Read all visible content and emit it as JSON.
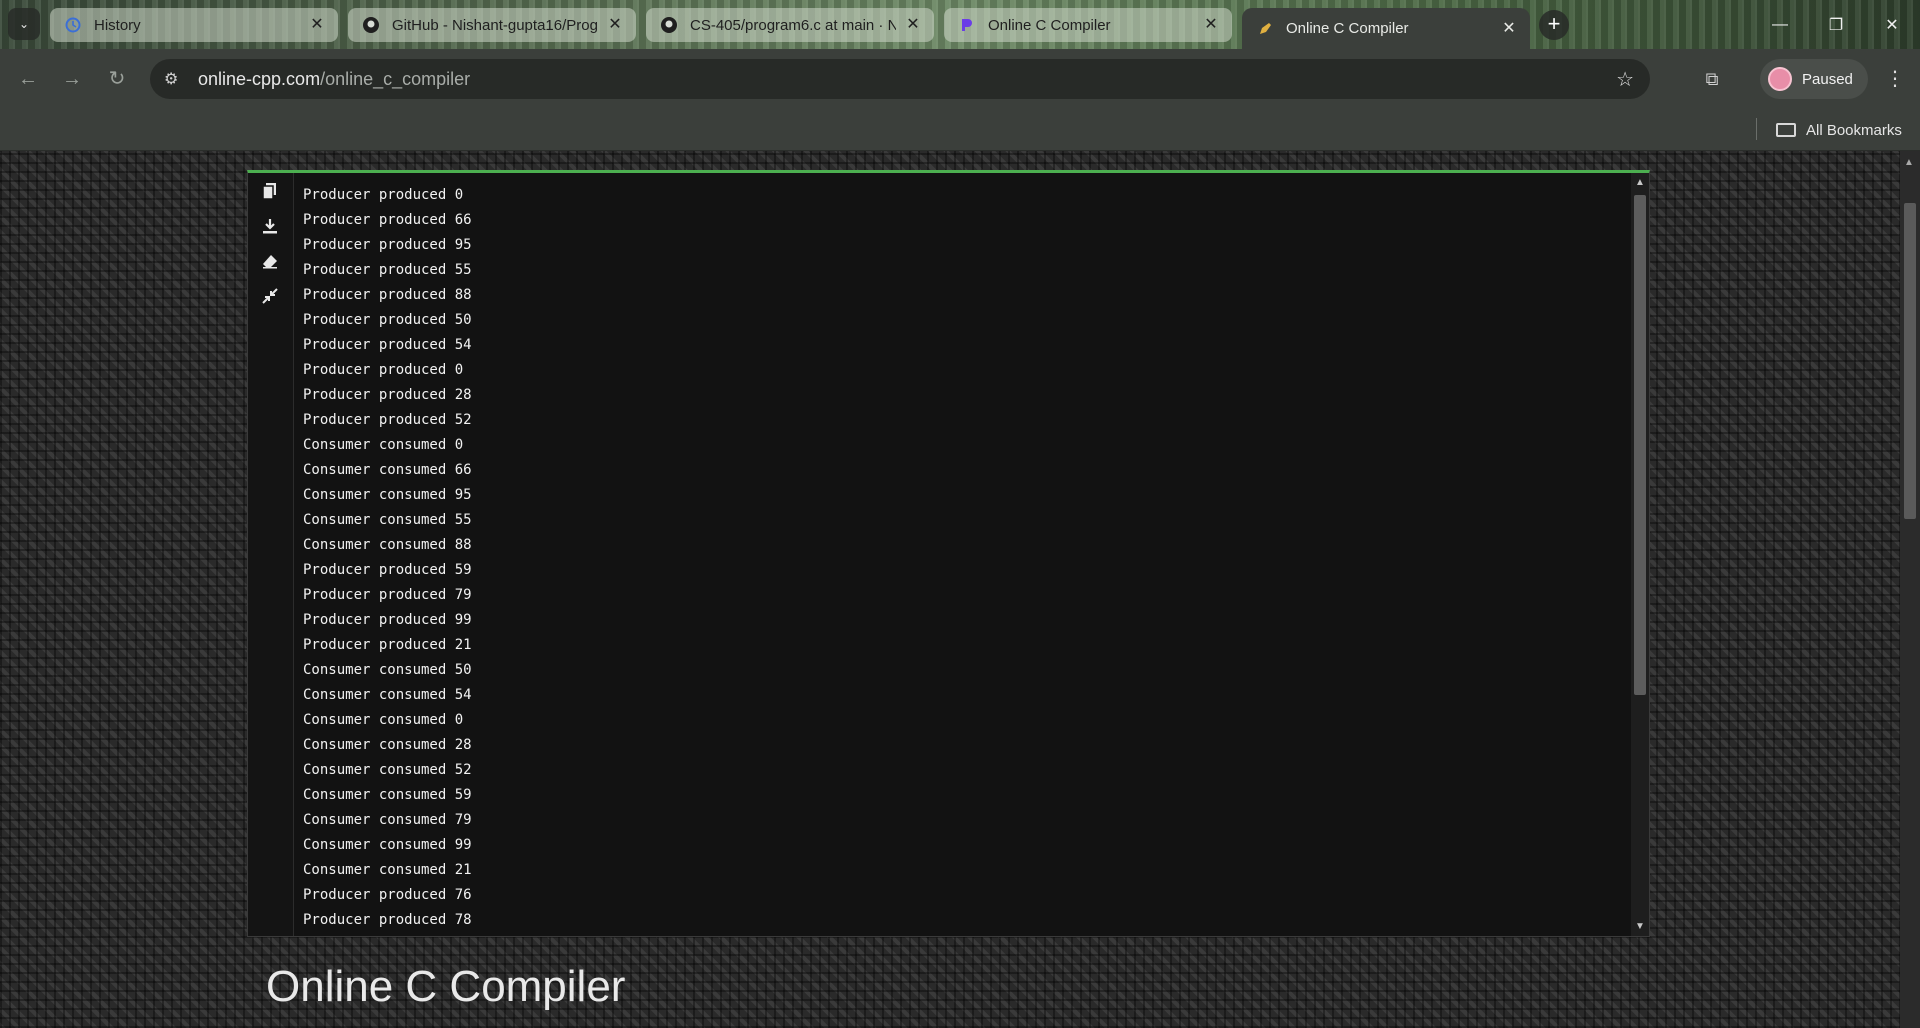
{
  "browser": {
    "tabs": [
      {
        "title": "History",
        "icon": "history-icon",
        "active": false
      },
      {
        "title": "GitHub - Nishant-gupta16/Prog",
        "icon": "github-icon",
        "active": false
      },
      {
        "title": "CS-405/program6.c at main · N",
        "icon": "github-icon",
        "active": false
      },
      {
        "title": "Online C Compiler",
        "icon": "compiler-p-icon",
        "active": false
      },
      {
        "title": "Online C Compiler",
        "icon": "compiler-pen-icon",
        "active": true
      }
    ],
    "url_host": "online-cpp.com",
    "url_path": "/online_c_compiler",
    "profile_label": "Paused",
    "bookmarks_label": "All Bookmarks"
  },
  "console": {
    "lines": [
      "Producer produced 0",
      "Producer produced 66",
      "Producer produced 95",
      "Producer produced 55",
      "Producer produced 88",
      "Producer produced 50",
      "Producer produced 54",
      "Producer produced 0",
      "Producer produced 28",
      "Producer produced 52",
      "Consumer consumed 0",
      "Consumer consumed 66",
      "Consumer consumed 95",
      "Consumer consumed 55",
      "Consumer consumed 88",
      "Producer produced 59",
      "Producer produced 79",
      "Producer produced 99",
      "Producer produced 21",
      "Consumer consumed 50",
      "Consumer consumed 54",
      "Consumer consumed 0",
      "Consumer consumed 28",
      "Consumer consumed 52",
      "Consumer consumed 59",
      "Consumer consumed 79",
      "Consumer consumed 99",
      "Consumer consumed 21",
      "Producer produced 76",
      "Producer produced 78"
    ],
    "side_tools": [
      "copy-icon",
      "download-icon",
      "eraser-icon",
      "collapse-icon"
    ],
    "accent_color": "#4caf50"
  },
  "page": {
    "title": "Online C Compiler"
  }
}
